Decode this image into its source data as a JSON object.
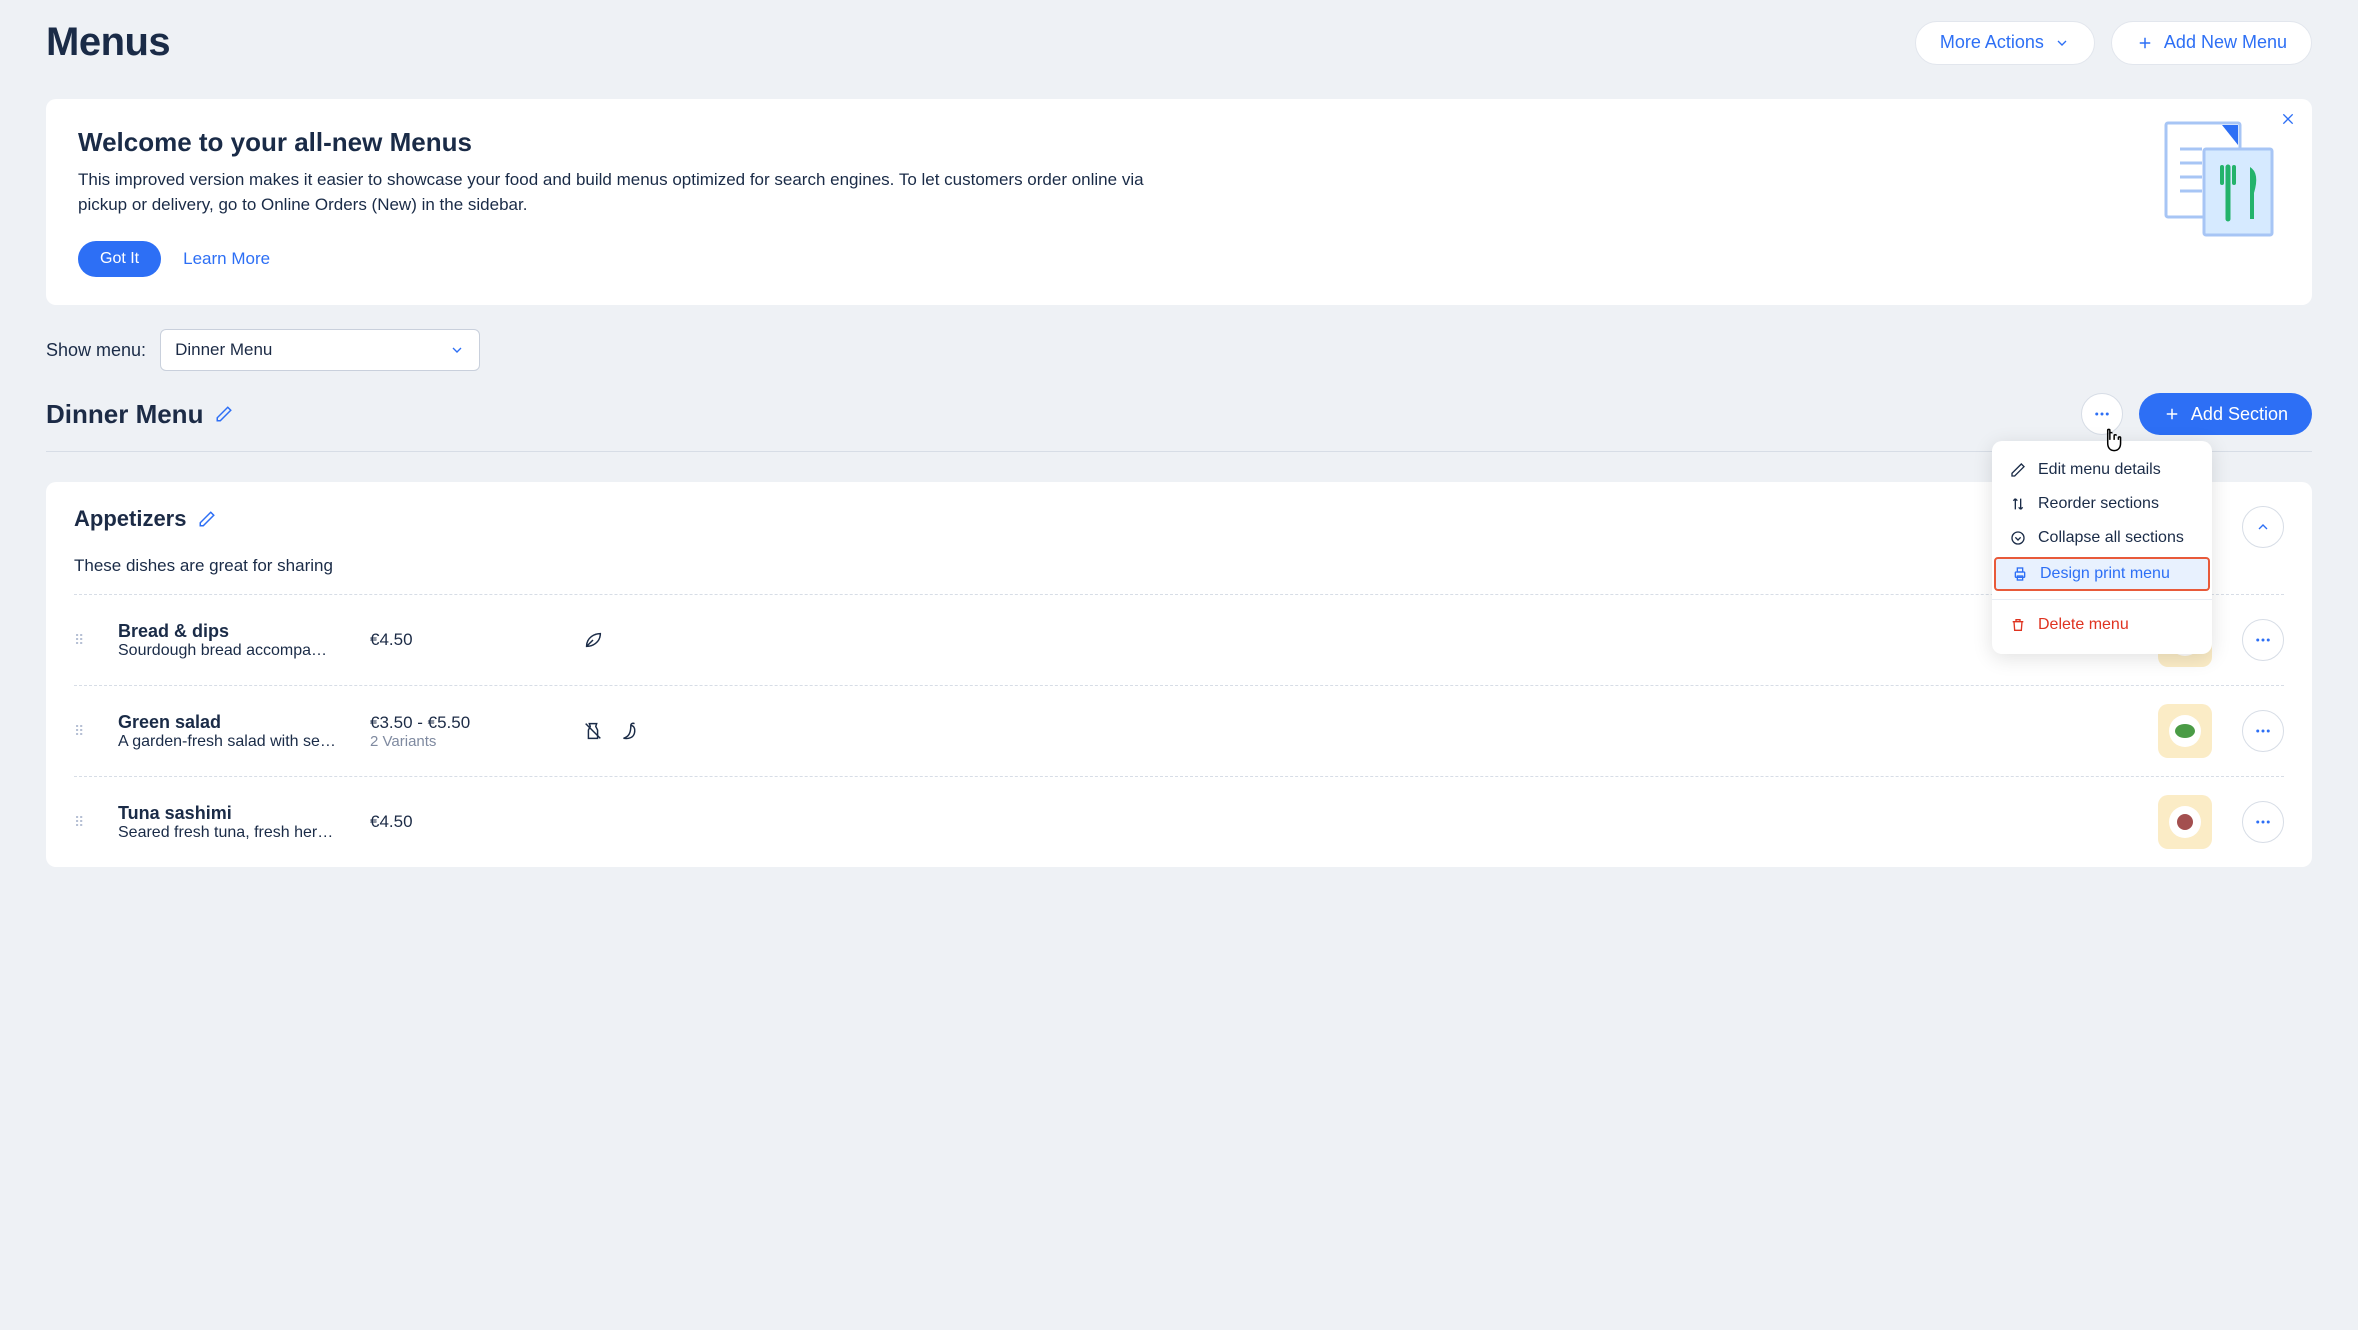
{
  "page": {
    "title": "Menus"
  },
  "header_actions": {
    "more_actions": "More Actions",
    "add_new_menu": "Add New Menu"
  },
  "banner": {
    "title": "Welcome to your all-new Menus",
    "body": "This improved version makes it easier to showcase your food and build menus optimized for search engines.  To let customers order online via pickup or delivery, go to Online Orders (New) in the sidebar.",
    "got_it": "Got It",
    "learn_more": "Learn More"
  },
  "show_menu": {
    "label": "Show menu:",
    "selected": "Dinner Menu"
  },
  "menu": {
    "name": "Dinner Menu",
    "add_section": "Add Section"
  },
  "popover": {
    "edit_menu_details": "Edit menu details",
    "reorder_sections": "Reorder sections",
    "collapse_all": "Collapse all sections",
    "design_print_menu": "Design print menu",
    "delete_menu": "Delete menu"
  },
  "section": {
    "title": "Appetizers",
    "description": "These dishes are great for sharing"
  },
  "items": [
    {
      "name": "Bread & dips",
      "desc": "Sourdough bread accompa…",
      "price": "€4.50",
      "variants": "",
      "badges": [
        "leaf"
      ]
    },
    {
      "name": "Green salad",
      "desc": "A garden-fresh salad with se…",
      "price": "€3.50 - €5.50",
      "variants": "2 Variants",
      "badges": [
        "no-dairy",
        "chili"
      ]
    },
    {
      "name": "Tuna sashimi",
      "desc": "Seared fresh tuna, fresh her…",
      "price": "€4.50",
      "variants": "",
      "badges": []
    }
  ]
}
